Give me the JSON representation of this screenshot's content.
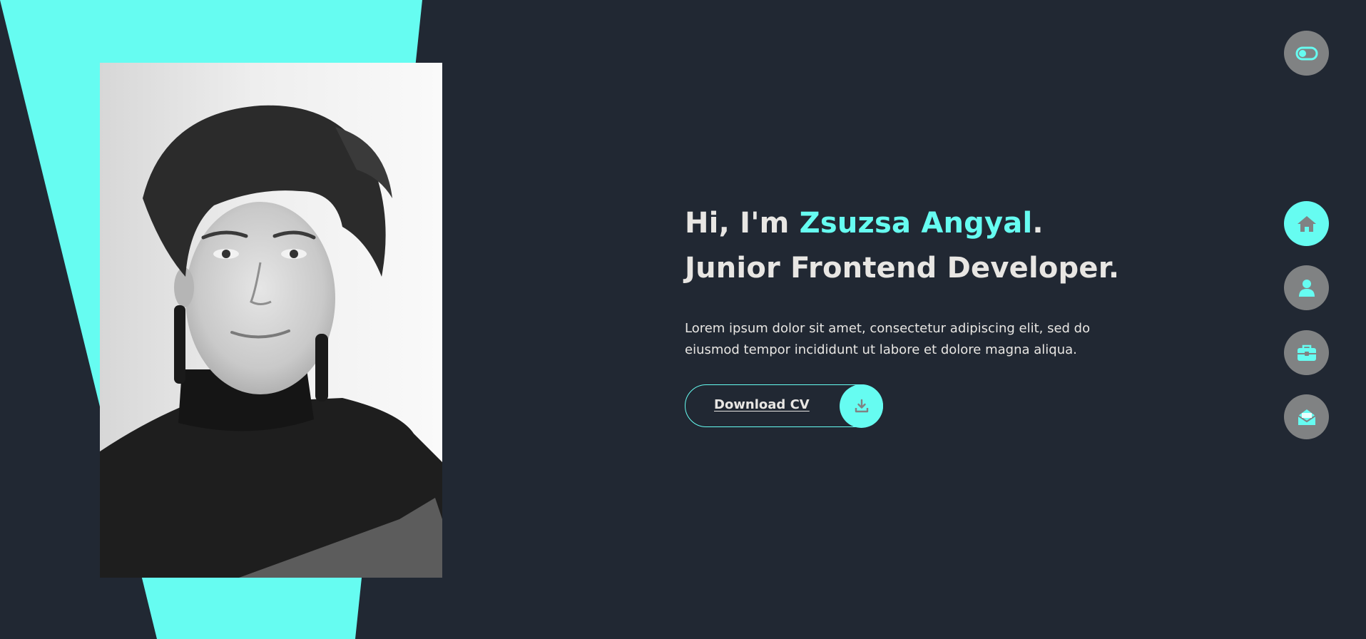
{
  "colors": {
    "background": "#212833",
    "accent": "#66fcf1",
    "text": "#e8e6e3",
    "nav_inactive": "#808283"
  },
  "theme_toggle": {
    "icon": "toggle-icon"
  },
  "hero": {
    "greeting": "Hi, I'm ",
    "name": "Zsuzsa Angyal",
    "greeting_end": ".",
    "role": "Junior Frontend Developer.",
    "description": "Lorem ipsum dolor sit amet, consectetur adipiscing elit, sed do eiusmod tempor incididunt ut labore et dolore magna aliqua.",
    "cta_label": "Download CV",
    "cta_icon": "download-icon"
  },
  "portrait": {
    "subject": "black-and-white portrait photo"
  },
  "nav": {
    "active": "home",
    "items": [
      {
        "id": "home",
        "icon": "home-icon"
      },
      {
        "id": "about",
        "icon": "user-icon"
      },
      {
        "id": "portfolio",
        "icon": "briefcase-icon"
      },
      {
        "id": "contact",
        "icon": "envelope-open-icon"
      }
    ]
  }
}
